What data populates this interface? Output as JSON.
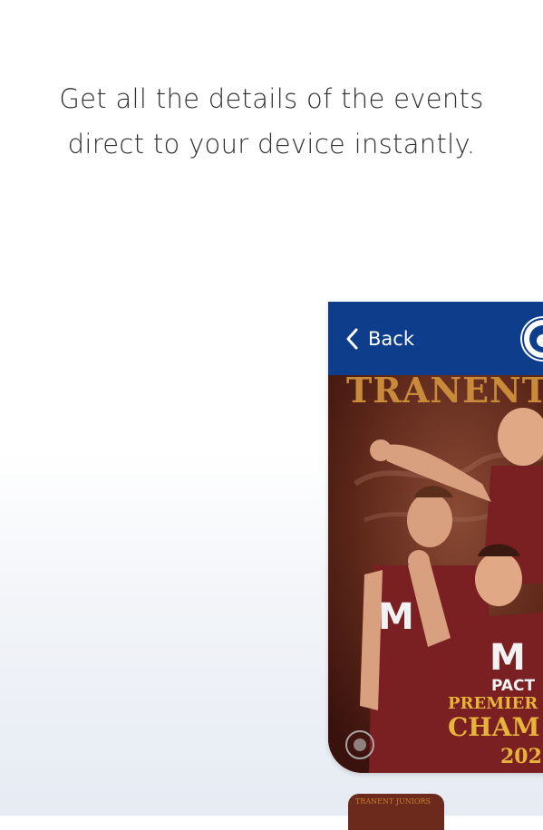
{
  "headline": {
    "line1": "Get all the details of the events",
    "line2": "direct to your device instantly."
  },
  "app_bar": {
    "back_label": "Back",
    "back_icon": "chevron-left-icon",
    "crest_icon": "club-crest-icon",
    "color": "#0e3d8c"
  },
  "poster": {
    "club_name": "TRANENT",
    "sponsor_line1": "M",
    "sponsor_line2": "PACT",
    "title1": "PREMIER",
    "title2": "CHAM",
    "year": "202",
    "kit_color": "#7a1f22",
    "text_color": "#e8b33a"
  },
  "bottom_thumb": {
    "label": "TRANENT JUNIORS"
  }
}
